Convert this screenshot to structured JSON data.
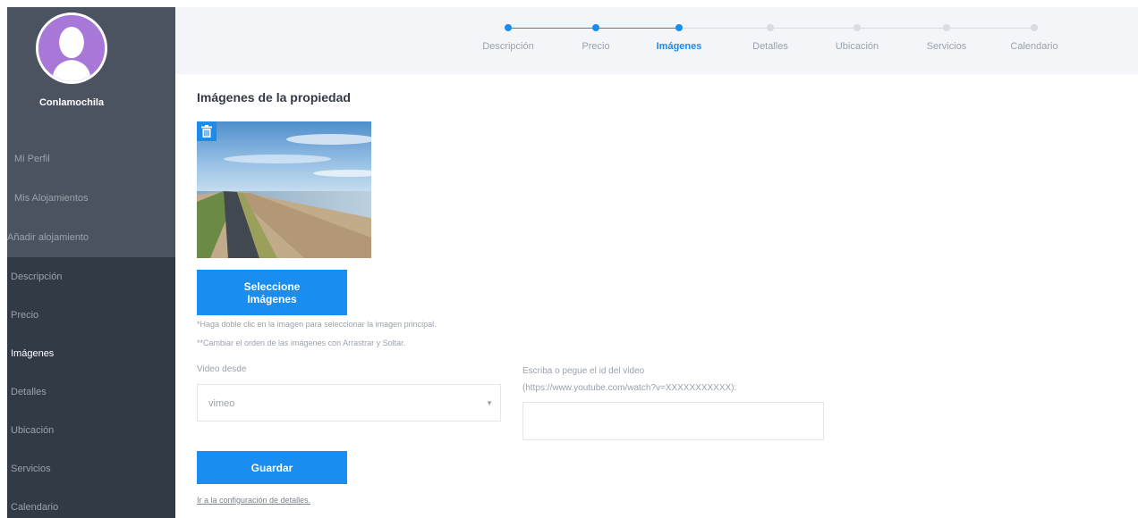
{
  "sidebar": {
    "username": "Conlamochila",
    "profile_links": [
      {
        "label": "Mi Perfil"
      },
      {
        "label": "Mis Alojamientos"
      },
      {
        "label": "Añadir alojamiento"
      }
    ],
    "sections": [
      {
        "label": "Descripción",
        "active": false
      },
      {
        "label": "Precio",
        "active": false
      },
      {
        "label": "Imágenes",
        "active": true
      },
      {
        "label": "Detalles",
        "active": false
      },
      {
        "label": "Ubicación",
        "active": false
      },
      {
        "label": "Servicios",
        "active": false
      },
      {
        "label": "Calendario",
        "active": false
      }
    ]
  },
  "steps": [
    {
      "label": "Descripción",
      "state": "done"
    },
    {
      "label": "Precio",
      "state": "done"
    },
    {
      "label": "Imágenes",
      "state": "current"
    },
    {
      "label": "Detalles",
      "state": "pending"
    },
    {
      "label": "Ubicación",
      "state": "pending"
    },
    {
      "label": "Servicios",
      "state": "pending"
    },
    {
      "label": "Calendario",
      "state": "pending"
    }
  ],
  "colors": {
    "accent": "#1a8ef0",
    "sidebar_dark": "#323a45",
    "sidebar_light": "#4b5360",
    "avatar": "#a878d8",
    "step_pending": "#d8dce2"
  },
  "main": {
    "title": "Imágenes de la propiedad",
    "select_button_label": "Seleccione\nImágenes",
    "note_1": "*Haga doble clic en la imagen para seleccionar la imagen principal.",
    "note_2": "**Cambiar el orden de las imágenes con Arrastrar y Soltar.",
    "video_source_label": "Video desde",
    "video_source_value": "vimeo",
    "video_id_label_1": "Escriba o pegue el id del video",
    "video_id_label_2": "(https://www.youtube.com/watch?v=XXXXXXXXXXX):",
    "video_id_value": "",
    "save_label": "Guardar",
    "details_link": "Ir a la configuración de detalles."
  },
  "icons": {
    "trash": "trash-icon",
    "dropdown": "chevron-down-icon",
    "avatar": "user-avatar-icon"
  }
}
